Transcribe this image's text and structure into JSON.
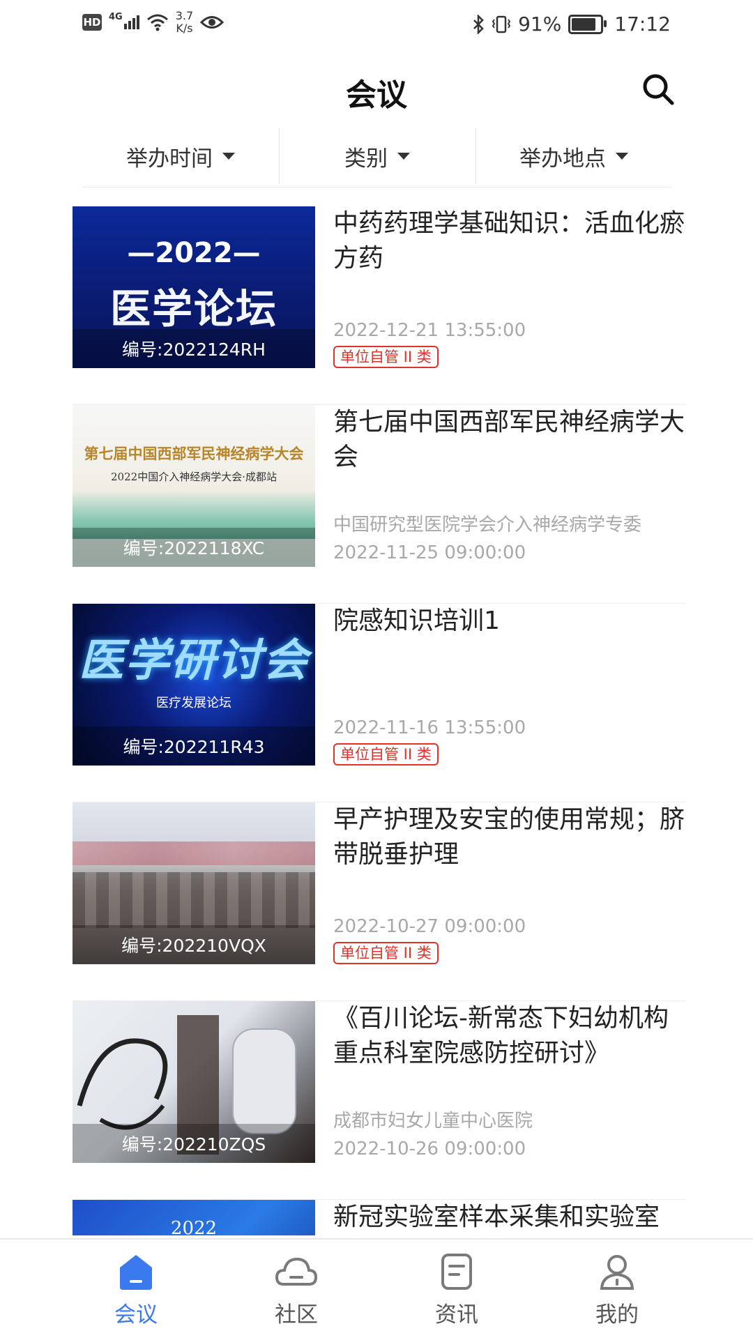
{
  "status_bar": {
    "network_badge": "HD",
    "network_type": "4G",
    "speed_value": "3.7",
    "speed_unit": "K/s",
    "battery_percent": "91%",
    "time": "17:12"
  },
  "header": {
    "title": "会议"
  },
  "filters": {
    "time_label": "举办时间",
    "category_label": "类别",
    "location_label": "举办地点"
  },
  "meetings": [
    {
      "code": "编号:2022124RH",
      "title": "中药药理学基础知识：活血化瘀方药",
      "organizer": "",
      "date": "2022-12-21 13:55:00",
      "badge": "单位自管 II 类",
      "thumb_main": "医学论坛",
      "thumb_year": "—2022—"
    },
    {
      "code": "编号:2022118XC",
      "title": "第七届中国西部军民神经病学大会",
      "organizer": "中国研究型医院学会介入神经病学专委",
      "date": "2022-11-25 09:00:00",
      "badge": "",
      "thumb_main": "第七届中国西部军民神经病学大会",
      "thumb_sub": "2022中国介入神经病学大会·成都站"
    },
    {
      "code": "编号:202211R43",
      "title": "院感知识培训1",
      "organizer": "",
      "date": "2022-11-16 13:55:00",
      "badge": "单位自管 II 类",
      "thumb_main": "医学研讨会",
      "thumb_sub": "医疗发展论坛"
    },
    {
      "code": "编号:202210VQX",
      "title": "早产护理及安宝的使用常规；脐带脱垂护理",
      "organizer": "",
      "date": "2022-10-27 09:00:00",
      "badge": "单位自管 II 类"
    },
    {
      "code": "编号:202210ZQS",
      "title": "《百川论坛-新常态下妇幼机构重点科室院感防控研讨》",
      "organizer": "成都市妇女儿童中心医院",
      "date": "2022-10-26 09:00:00",
      "badge": ""
    },
    {
      "code": "",
      "title": "新冠实验室样本采集和实验室",
      "organizer": "",
      "date": "",
      "badge": "",
      "thumb_year": "2022"
    }
  ],
  "bottom_nav": {
    "meeting": "会议",
    "community": "社区",
    "news": "资讯",
    "mine": "我的"
  },
  "colors": {
    "accent": "#3b79ee",
    "badge_red": "#e0322b",
    "meta_gray": "#a8a8a8"
  }
}
